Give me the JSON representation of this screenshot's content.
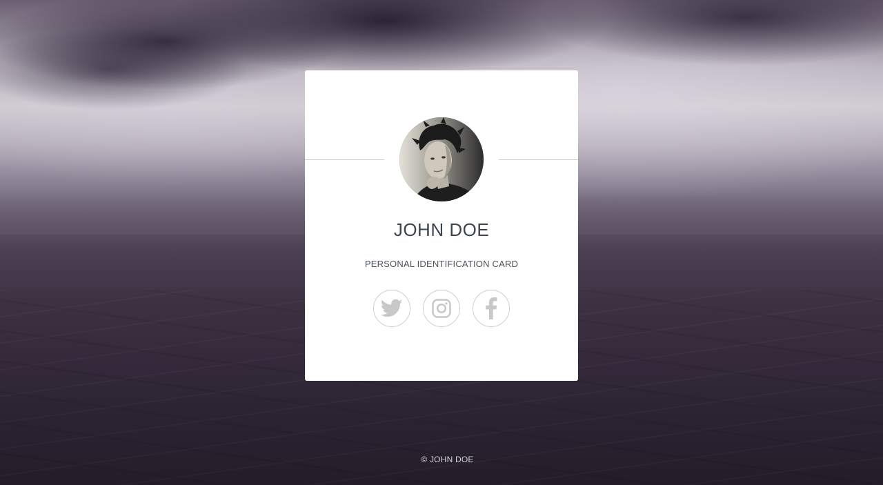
{
  "profile": {
    "name": "JOHN DOE",
    "subtitle": "PERSONAL IDENTIFICATION CARD",
    "avatar_alt": "Profile photo"
  },
  "social": [
    {
      "icon": "twitter-icon",
      "label": "Twitter"
    },
    {
      "icon": "instagram-icon",
      "label": "Instagram"
    },
    {
      "icon": "facebook-icon",
      "label": "Facebook"
    }
  ],
  "footer": {
    "copyright": "© JOHN DOE"
  },
  "colors": {
    "card_bg": "#ffffff",
    "text_primary": "#3d4650",
    "icon_gray": "#c8c8c8",
    "footer_text": "#d9d4dc"
  }
}
